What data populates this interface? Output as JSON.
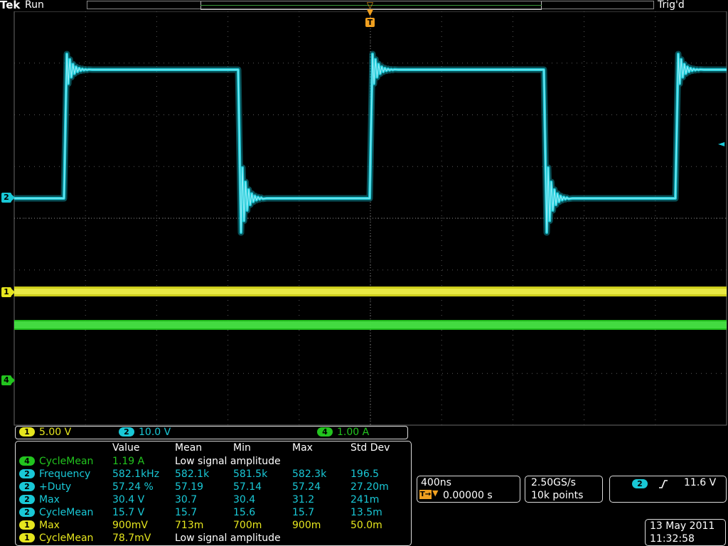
{
  "header": {
    "brand": "Tek",
    "run_state": "Run",
    "trigger_state": "Trig'd"
  },
  "trigger": {
    "marker": "T"
  },
  "channels": [
    {
      "num": "1",
      "color": "#e6e61e",
      "scale": "5.00 V"
    },
    {
      "num": "2",
      "color": "#19c8d6",
      "scale": "10.0 V"
    },
    {
      "num": "4",
      "color": "#22c41e",
      "scale": "1.00 A"
    }
  ],
  "measurements": {
    "headers": [
      "Value",
      "Mean",
      "Min",
      "Max",
      "Std Dev"
    ],
    "rows": [
      {
        "ch": "4",
        "color": "#22c41e",
        "name": "CycleMean",
        "value": "1.19 A",
        "mean": "Low signal amplitude",
        "min": "",
        "max": "",
        "std": ""
      },
      {
        "ch": "2",
        "color": "#19c8d6",
        "name": "Frequency",
        "value": "582.1kHz",
        "mean": "582.1k",
        "min": "581.5k",
        "max": "582.3k",
        "std": "196.5"
      },
      {
        "ch": "2",
        "color": "#19c8d6",
        "name": "+Duty",
        "value": "57.24 %",
        "mean": "57.19",
        "min": "57.14",
        "max": "57.24",
        "std": "27.20m"
      },
      {
        "ch": "2",
        "color": "#19c8d6",
        "name": "Max",
        "value": "30.4 V",
        "mean": "30.7",
        "min": "30.4",
        "max": "31.2",
        "std": "241m"
      },
      {
        "ch": "2",
        "color": "#19c8d6",
        "name": "CycleMean",
        "value": "15.7 V",
        "mean": "15.7",
        "min": "15.6",
        "max": "15.7",
        "std": "13.5m"
      },
      {
        "ch": "1",
        "color": "#e6e61e",
        "name": "Max",
        "value": "900mV",
        "mean": "713m",
        "min": "700m",
        "max": "900m",
        "std": "50.0m"
      },
      {
        "ch": "1",
        "color": "#e6e61e",
        "name": "CycleMean",
        "value": "78.7mV",
        "mean": "Low signal amplitude",
        "min": "",
        "max": "",
        "std": ""
      }
    ]
  },
  "timebase": {
    "scale": "400ns",
    "trigger_position": "0.00000 s"
  },
  "sample": {
    "rate": "2.50GS/s",
    "record": "10k points"
  },
  "trigger_readout": {
    "channel": "2",
    "slope": "rising",
    "level": "11.6 V"
  },
  "datetime": {
    "date": "13 May 2011",
    "time": "11:32:58"
  }
}
